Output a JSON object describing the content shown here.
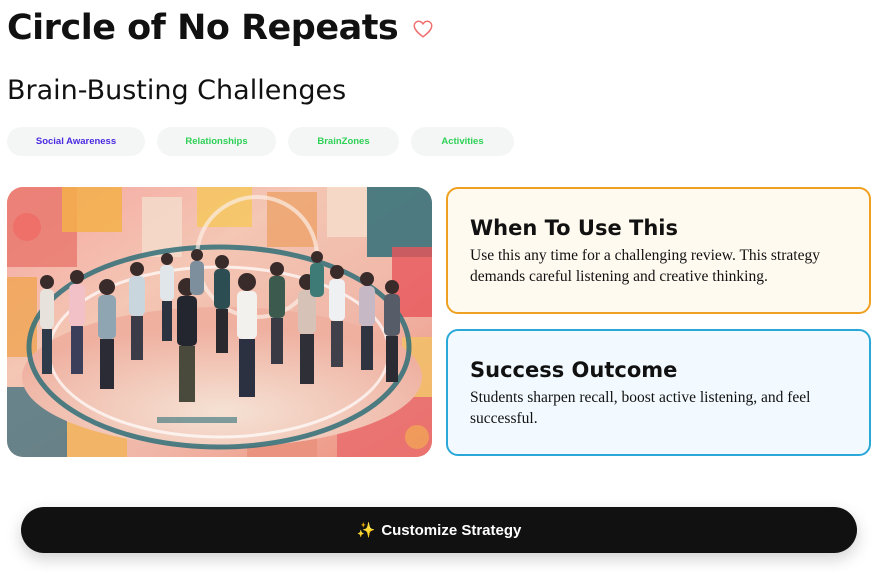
{
  "header": {
    "title": "Circle of No Repeats",
    "subtitle": "Brain-Busting Challenges"
  },
  "tags": [
    {
      "label": "Social Awareness",
      "color": "#4a2be0"
    },
    {
      "label": "Relationships",
      "color": "#2ed156"
    },
    {
      "label": "BrainZones",
      "color": "#2ed156"
    },
    {
      "label": "Activities",
      "color": "#2ed156"
    }
  ],
  "cards": {
    "when": {
      "heading": "When To Use This",
      "body": "Use this any time for a challenging review. This strategy demands careful listening and creative thinking.",
      "border_color": "#f0a020",
      "bg_color": "#fffaf0"
    },
    "outcome": {
      "heading": "Success Outcome",
      "body": "Students sharpen recall, boost active listening, and feel successful.",
      "border_color": "#2aa8d8",
      "bg_color": "#f2faff"
    }
  },
  "cta": {
    "icon": "sparkles-icon",
    "glyph": "✨",
    "label": "Customize Strategy"
  },
  "colors": {
    "heart": "#f07070"
  }
}
